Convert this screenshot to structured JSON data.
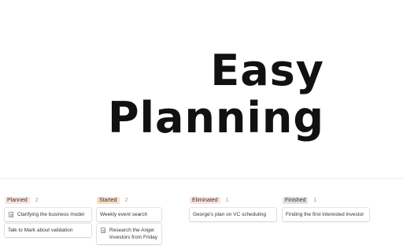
{
  "hero": {
    "line1": "Easy",
    "line2": "Planning"
  },
  "board": {
    "columns": [
      {
        "label": "Planned",
        "count": "2",
        "tag_color": "#fbe4dd",
        "cards": [
          {
            "title": "Clarifying the business model",
            "icon": "page-icon"
          },
          {
            "title": "Talk to Mark about validation",
            "icon": ""
          }
        ]
      },
      {
        "label": "Started",
        "count": "2",
        "tag_color": "#fadec9",
        "cards": [
          {
            "title": "Weekly event search",
            "icon": ""
          },
          {
            "title": "Research the Angel Investors from Friday",
            "icon": "page-icon"
          }
        ]
      },
      {
        "label": "Eliminated",
        "count": "1",
        "tag_color": "#ffe2dd",
        "cards": [
          {
            "title": "George's plan on VC scheduling",
            "icon": ""
          }
        ]
      },
      {
        "label": "Finished",
        "count": "1",
        "tag_color": "#e3e2e0",
        "cards": [
          {
            "title": "Finding the first interested investor",
            "icon": ""
          }
        ]
      }
    ]
  }
}
